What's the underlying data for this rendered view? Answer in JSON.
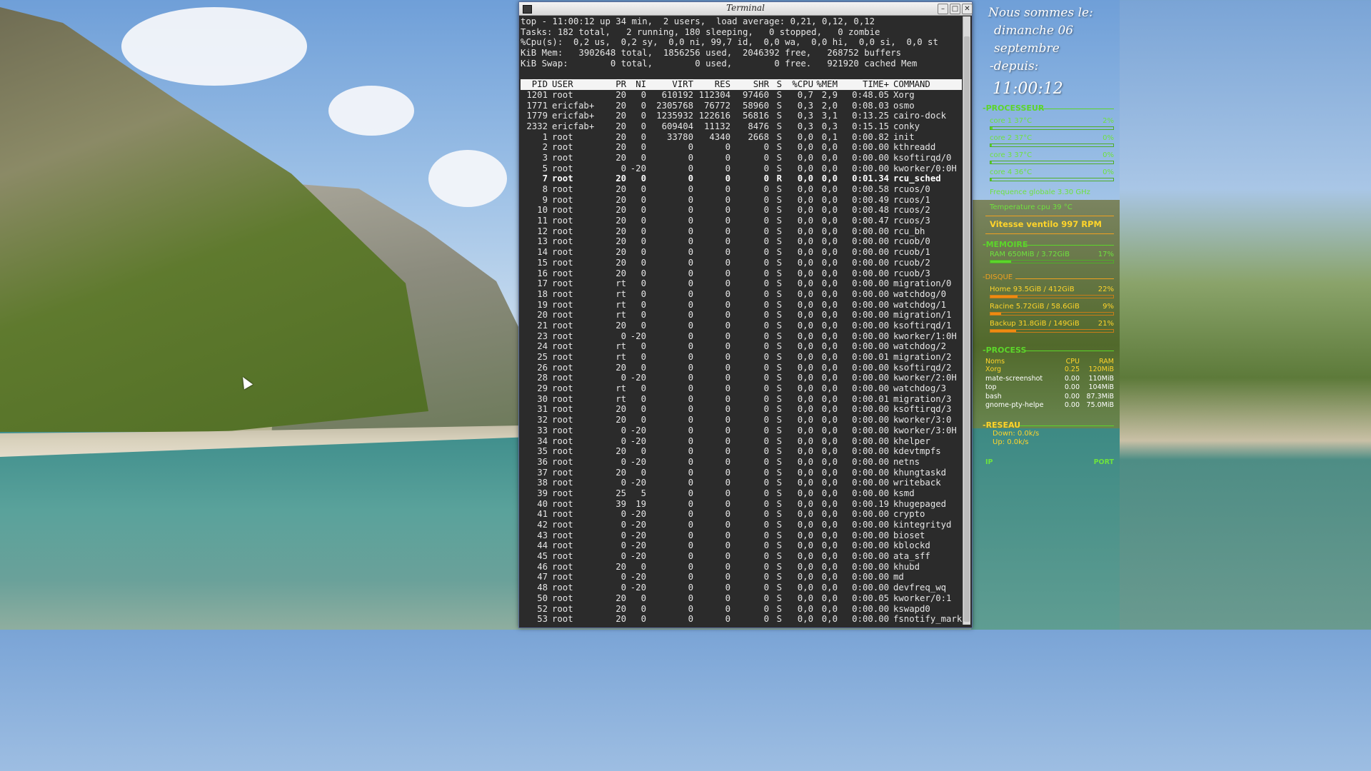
{
  "terminal": {
    "title": "Terminal",
    "header_lines": [
      "top - 11:00:12 up 34 min,  2 users,  load average: 0,21, 0,12, 0,12",
      "Tasks: 182 total,   2 running, 180 sleeping,   0 stopped,   0 zombie",
      "%Cpu(s):  0,2 us,  0,2 sy,  0,0 ni, 99,7 id,  0,0 wa,  0,0 hi,  0,0 si,  0,0 st",
      "KiB Mem:   3902648 total,  1856256 used,  2046392 free,   268752 buffers",
      "KiB Swap:        0 total,        0 used,        0 free.   921920 cached Mem"
    ],
    "columns": [
      "PID",
      "USER",
      "PR",
      "NI",
      "VIRT",
      "RES",
      "SHR",
      "S",
      "%CPU",
      "%MEM",
      "TIME+",
      "COMMAND"
    ],
    "processes": [
      [
        "1201",
        "root",
        "20",
        "0",
        "610192",
        "112304",
        "97460",
        "S",
        "0,7",
        "2,9",
        "0:48.05",
        "Xorg"
      ],
      [
        "1771",
        "ericfab+",
        "20",
        "0",
        "2305768",
        "76772",
        "58960",
        "S",
        "0,3",
        "2,0",
        "0:08.03",
        "osmo"
      ],
      [
        "1779",
        "ericfab+",
        "20",
        "0",
        "1235932",
        "122616",
        "56816",
        "S",
        "0,3",
        "3,1",
        "0:13.25",
        "cairo-dock"
      ],
      [
        "2332",
        "ericfab+",
        "20",
        "0",
        "609404",
        "11132",
        "8476",
        "S",
        "0,3",
        "0,3",
        "0:15.15",
        "conky"
      ],
      [
        "1",
        "root",
        "20",
        "0",
        "33780",
        "4340",
        "2668",
        "S",
        "0,0",
        "0,1",
        "0:00.82",
        "init"
      ],
      [
        "2",
        "root",
        "20",
        "0",
        "0",
        "0",
        "0",
        "S",
        "0,0",
        "0,0",
        "0:00.00",
        "kthreadd"
      ],
      [
        "3",
        "root",
        "20",
        "0",
        "0",
        "0",
        "0",
        "S",
        "0,0",
        "0,0",
        "0:00.00",
        "ksoftirqd/0"
      ],
      [
        "5",
        "root",
        "0",
        "-20",
        "0",
        "0",
        "0",
        "S",
        "0,0",
        "0,0",
        "0:00.00",
        "kworker/0:0H"
      ],
      [
        "7",
        "root",
        "20",
        "0",
        "0",
        "0",
        "0",
        "R",
        "0,0",
        "0,0",
        "0:01.34",
        "rcu_sched"
      ],
      [
        "8",
        "root",
        "20",
        "0",
        "0",
        "0",
        "0",
        "S",
        "0,0",
        "0,0",
        "0:00.58",
        "rcuos/0"
      ],
      [
        "9",
        "root",
        "20",
        "0",
        "0",
        "0",
        "0",
        "S",
        "0,0",
        "0,0",
        "0:00.49",
        "rcuos/1"
      ],
      [
        "10",
        "root",
        "20",
        "0",
        "0",
        "0",
        "0",
        "S",
        "0,0",
        "0,0",
        "0:00.48",
        "rcuos/2"
      ],
      [
        "11",
        "root",
        "20",
        "0",
        "0",
        "0",
        "0",
        "S",
        "0,0",
        "0,0",
        "0:00.47",
        "rcuos/3"
      ],
      [
        "12",
        "root",
        "20",
        "0",
        "0",
        "0",
        "0",
        "S",
        "0,0",
        "0,0",
        "0:00.00",
        "rcu_bh"
      ],
      [
        "13",
        "root",
        "20",
        "0",
        "0",
        "0",
        "0",
        "S",
        "0,0",
        "0,0",
        "0:00.00",
        "rcuob/0"
      ],
      [
        "14",
        "root",
        "20",
        "0",
        "0",
        "0",
        "0",
        "S",
        "0,0",
        "0,0",
        "0:00.00",
        "rcuob/1"
      ],
      [
        "15",
        "root",
        "20",
        "0",
        "0",
        "0",
        "0",
        "S",
        "0,0",
        "0,0",
        "0:00.00",
        "rcuob/2"
      ],
      [
        "16",
        "root",
        "20",
        "0",
        "0",
        "0",
        "0",
        "S",
        "0,0",
        "0,0",
        "0:00.00",
        "rcuob/3"
      ],
      [
        "17",
        "root",
        "rt",
        "0",
        "0",
        "0",
        "0",
        "S",
        "0,0",
        "0,0",
        "0:00.00",
        "migration/0"
      ],
      [
        "18",
        "root",
        "rt",
        "0",
        "0",
        "0",
        "0",
        "S",
        "0,0",
        "0,0",
        "0:00.00",
        "watchdog/0"
      ],
      [
        "19",
        "root",
        "rt",
        "0",
        "0",
        "0",
        "0",
        "S",
        "0,0",
        "0,0",
        "0:00.00",
        "watchdog/1"
      ],
      [
        "20",
        "root",
        "rt",
        "0",
        "0",
        "0",
        "0",
        "S",
        "0,0",
        "0,0",
        "0:00.00",
        "migration/1"
      ],
      [
        "21",
        "root",
        "20",
        "0",
        "0",
        "0",
        "0",
        "S",
        "0,0",
        "0,0",
        "0:00.00",
        "ksoftirqd/1"
      ],
      [
        "23",
        "root",
        "0",
        "-20",
        "0",
        "0",
        "0",
        "S",
        "0,0",
        "0,0",
        "0:00.00",
        "kworker/1:0H"
      ],
      [
        "24",
        "root",
        "rt",
        "0",
        "0",
        "0",
        "0",
        "S",
        "0,0",
        "0,0",
        "0:00.00",
        "watchdog/2"
      ],
      [
        "25",
        "root",
        "rt",
        "0",
        "0",
        "0",
        "0",
        "S",
        "0,0",
        "0,0",
        "0:00.01",
        "migration/2"
      ],
      [
        "26",
        "root",
        "20",
        "0",
        "0",
        "0",
        "0",
        "S",
        "0,0",
        "0,0",
        "0:00.00",
        "ksoftirqd/2"
      ],
      [
        "28",
        "root",
        "0",
        "-20",
        "0",
        "0",
        "0",
        "S",
        "0,0",
        "0,0",
        "0:00.00",
        "kworker/2:0H"
      ],
      [
        "29",
        "root",
        "rt",
        "0",
        "0",
        "0",
        "0",
        "S",
        "0,0",
        "0,0",
        "0:00.00",
        "watchdog/3"
      ],
      [
        "30",
        "root",
        "rt",
        "0",
        "0",
        "0",
        "0",
        "S",
        "0,0",
        "0,0",
        "0:00.01",
        "migration/3"
      ],
      [
        "31",
        "root",
        "20",
        "0",
        "0",
        "0",
        "0",
        "S",
        "0,0",
        "0,0",
        "0:00.00",
        "ksoftirqd/3"
      ],
      [
        "32",
        "root",
        "20",
        "0",
        "0",
        "0",
        "0",
        "S",
        "0,0",
        "0,0",
        "0:00.00",
        "kworker/3:0"
      ],
      [
        "33",
        "root",
        "0",
        "-20",
        "0",
        "0",
        "0",
        "S",
        "0,0",
        "0,0",
        "0:00.00",
        "kworker/3:0H"
      ],
      [
        "34",
        "root",
        "0",
        "-20",
        "0",
        "0",
        "0",
        "S",
        "0,0",
        "0,0",
        "0:00.00",
        "khelper"
      ],
      [
        "35",
        "root",
        "20",
        "0",
        "0",
        "0",
        "0",
        "S",
        "0,0",
        "0,0",
        "0:00.00",
        "kdevtmpfs"
      ],
      [
        "36",
        "root",
        "0",
        "-20",
        "0",
        "0",
        "0",
        "S",
        "0,0",
        "0,0",
        "0:00.00",
        "netns"
      ],
      [
        "37",
        "root",
        "20",
        "0",
        "0",
        "0",
        "0",
        "S",
        "0,0",
        "0,0",
        "0:00.00",
        "khungtaskd"
      ],
      [
        "38",
        "root",
        "0",
        "-20",
        "0",
        "0",
        "0",
        "S",
        "0,0",
        "0,0",
        "0:00.00",
        "writeback"
      ],
      [
        "39",
        "root",
        "25",
        "5",
        "0",
        "0",
        "0",
        "S",
        "0,0",
        "0,0",
        "0:00.00",
        "ksmd"
      ],
      [
        "40",
        "root",
        "39",
        "19",
        "0",
        "0",
        "0",
        "S",
        "0,0",
        "0,0",
        "0:00.19",
        "khugepaged"
      ],
      [
        "41",
        "root",
        "0",
        "-20",
        "0",
        "0",
        "0",
        "S",
        "0,0",
        "0,0",
        "0:00.00",
        "crypto"
      ],
      [
        "42",
        "root",
        "0",
        "-20",
        "0",
        "0",
        "0",
        "S",
        "0,0",
        "0,0",
        "0:00.00",
        "kintegrityd"
      ],
      [
        "43",
        "root",
        "0",
        "-20",
        "0",
        "0",
        "0",
        "S",
        "0,0",
        "0,0",
        "0:00.00",
        "bioset"
      ],
      [
        "44",
        "root",
        "0",
        "-20",
        "0",
        "0",
        "0",
        "S",
        "0,0",
        "0,0",
        "0:00.00",
        "kblockd"
      ],
      [
        "45",
        "root",
        "0",
        "-20",
        "0",
        "0",
        "0",
        "S",
        "0,0",
        "0,0",
        "0:00.00",
        "ata_sff"
      ],
      [
        "46",
        "root",
        "20",
        "0",
        "0",
        "0",
        "0",
        "S",
        "0,0",
        "0,0",
        "0:00.00",
        "khubd"
      ],
      [
        "47",
        "root",
        "0",
        "-20",
        "0",
        "0",
        "0",
        "S",
        "0,0",
        "0,0",
        "0:00.00",
        "md"
      ],
      [
        "48",
        "root",
        "0",
        "-20",
        "0",
        "0",
        "0",
        "S",
        "0,0",
        "0,0",
        "0:00.00",
        "devfreq_wq"
      ],
      [
        "50",
        "root",
        "20",
        "0",
        "0",
        "0",
        "0",
        "S",
        "0,0",
        "0,0",
        "0:00.05",
        "kworker/0:1"
      ],
      [
        "52",
        "root",
        "20",
        "0",
        "0",
        "0",
        "0",
        "S",
        "0,0",
        "0,0",
        "0:00.00",
        "kswapd0"
      ],
      [
        "53",
        "root",
        "20",
        "0",
        "0",
        "0",
        "0",
        "S",
        "0,0",
        "0,0",
        "0:00.00",
        "fsnotify_mark"
      ]
    ],
    "bold_pid": "7"
  },
  "conky": {
    "greeting": "Nous sommes le:",
    "date": "dimanche 06 septembre",
    "since": "-depuis:",
    "clock": "11:00:12",
    "processor": {
      "title": "-PROCESSEUR",
      "cores": [
        {
          "label": "core 1  37°C",
          "value": "2%",
          "fraction": 0.02
        },
        {
          "label": "core 2  37°C",
          "value": "0%",
          "fraction": 0.0
        },
        {
          "label": "core 3  37°C",
          "value": "0%",
          "fraction": 0.0
        },
        {
          "label": "core 4  36°C",
          "value": "0%",
          "fraction": 0.0
        }
      ],
      "frequency": "Frequence globale 3.30 GHz",
      "temperature": "Temperature cpu 39 °C",
      "fan": "Vitesse ventilo 997 RPM"
    },
    "memory": {
      "title": "-MEMOIRE",
      "label": "RAM  650MiB / 3.72GiB",
      "value": "17%",
      "fraction": 0.17
    },
    "disk": {
      "title": "-DISQUE",
      "items": [
        {
          "label": "Home  93.5GiB / 412GiB",
          "value": "22%",
          "fraction": 0.22
        },
        {
          "label": "Racine  5.72GiB / 58.6GiB",
          "value": "9%",
          "fraction": 0.09
        },
        {
          "label": "Backup  31.8GiB / 149GiB",
          "value": "21%",
          "fraction": 0.21
        }
      ]
    },
    "process": {
      "title": "-PROCESS",
      "headers": [
        "Noms",
        "CPU",
        "RAM"
      ],
      "rows": [
        [
          "Xorg",
          "0.25",
          "120MiB"
        ],
        [
          "mate-screenshot",
          "0.00",
          "110MiB"
        ],
        [
          "top",
          "0.00",
          "104MiB"
        ],
        [
          "bash",
          "0.00",
          "87.3MiB"
        ],
        [
          "gnome-pty-helpe",
          "0.00",
          "75.0MiB"
        ]
      ]
    },
    "network": {
      "title": "-RESEAU",
      "down": "Down: 0.0k/s",
      "up": "Up: 0.0k/s",
      "ip_label": "IP",
      "port_label": "PORT"
    }
  }
}
